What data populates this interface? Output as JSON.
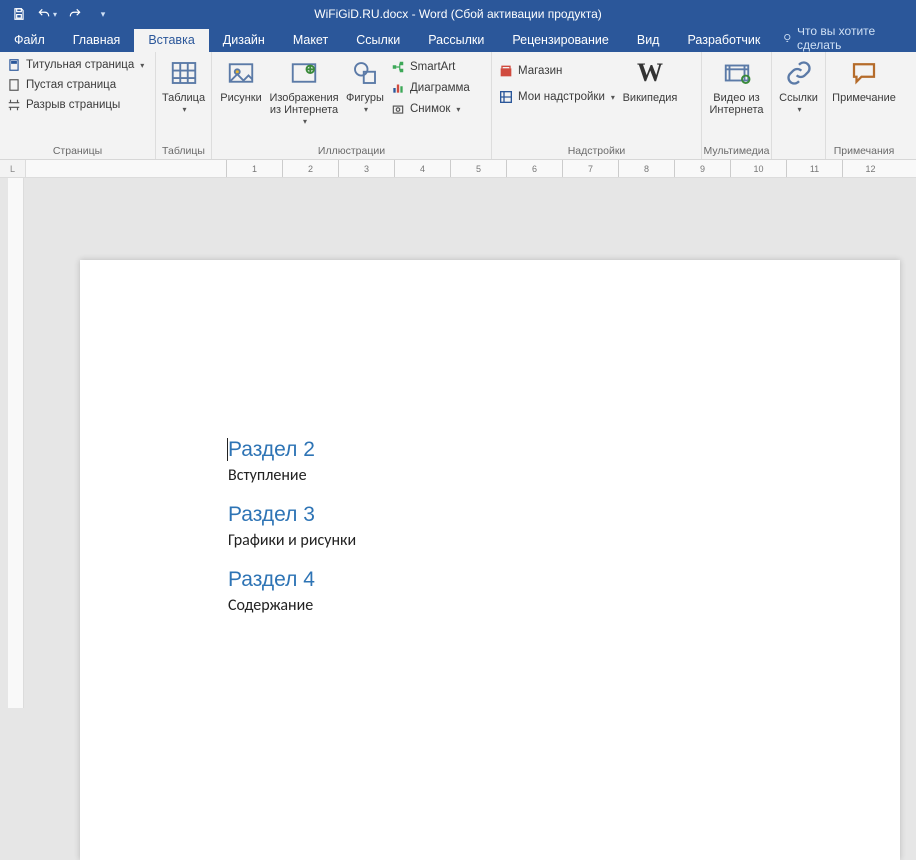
{
  "titlebar": {
    "title": "WiFiGiD.RU.docx - Word (Сбой активации продукта)"
  },
  "tabs": {
    "file": "Файл",
    "home": "Главная",
    "insert": "Вставка",
    "design": "Дизайн",
    "layout": "Макет",
    "references": "Ссылки",
    "mailings": "Рассылки",
    "review": "Рецензирование",
    "view": "Вид",
    "developer": "Разработчик",
    "tellme": "Что вы хотите сделать"
  },
  "ribbon": {
    "pages": {
      "cover": "Титульная страница",
      "blank": "Пустая страница",
      "break": "Разрыв страницы",
      "label": "Страницы"
    },
    "tables": {
      "table": "Таблица",
      "label": "Таблицы"
    },
    "illus": {
      "pictures": "Рисунки",
      "online": "Изображения из Интернета",
      "shapes": "Фигуры",
      "smartart": "SmartArt",
      "chart": "Диаграмма",
      "screenshot": "Снимок",
      "label": "Иллюстрации"
    },
    "addins": {
      "store": "Магазин",
      "myaddins": "Мои надстройки",
      "wikipedia": "Википедия",
      "label": "Надстройки"
    },
    "media": {
      "video": "Видео из Интернета",
      "label": "Мультимедиа"
    },
    "links": {
      "links": "Ссылки",
      "label": ""
    },
    "comments": {
      "comment": "Примечание",
      "label": "Примечания"
    }
  },
  "ruler": {
    "marks": [
      "1",
      "2",
      "3",
      "4",
      "5",
      "6",
      "7",
      "8",
      "9",
      "10",
      "11",
      "12"
    ]
  },
  "doc": {
    "h2a": "Раздел 2",
    "p1": "Вступление",
    "h2b": "Раздел 3",
    "p2": "Графики и рисунки",
    "h2c": "Раздел 4",
    "p3": "Содержание"
  }
}
